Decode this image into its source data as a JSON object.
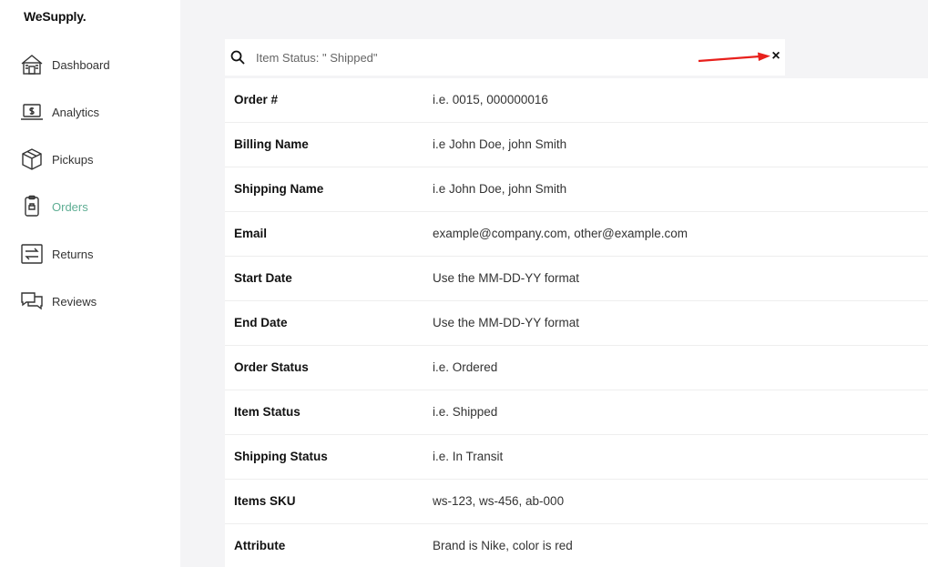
{
  "app": {
    "logo": "WeSupply."
  },
  "sidebar": {
    "items": [
      {
        "label": "Dashboard",
        "icon": "dashboard-icon",
        "active": false
      },
      {
        "label": "Analytics",
        "icon": "analytics-icon",
        "active": false
      },
      {
        "label": "Pickups",
        "icon": "pickups-icon",
        "active": false
      },
      {
        "label": "Orders",
        "icon": "orders-icon",
        "active": true
      },
      {
        "label": "Returns",
        "icon": "returns-icon",
        "active": false
      },
      {
        "label": "Reviews",
        "icon": "reviews-icon",
        "active": false
      }
    ]
  },
  "search": {
    "value": "Item Status: \" Shipped\"",
    "close_icon": "×"
  },
  "filters": [
    {
      "label": "Order #",
      "hint": "i.e. 0015, 000000016"
    },
    {
      "label": "Billing Name",
      "hint": "i.e John Doe, john Smith"
    },
    {
      "label": "Shipping Name",
      "hint": "i.e John Doe, john Smith"
    },
    {
      "label": "Email",
      "hint": "example@company.com, other@example.com"
    },
    {
      "label": "Start Date",
      "hint": "Use the MM-DD-YY format"
    },
    {
      "label": "End Date",
      "hint": "Use the MM-DD-YY format"
    },
    {
      "label": "Order Status",
      "hint": "i.e. Ordered"
    },
    {
      "label": "Item Status",
      "hint": "i.e. Shipped"
    },
    {
      "label": "Shipping Status",
      "hint": "i.e. In Transit"
    },
    {
      "label": "Items SKU",
      "hint": "ws-123, ws-456, ab-000"
    },
    {
      "label": "Attribute",
      "hint": "Brand is Nike, color is red"
    }
  ],
  "colors": {
    "active_nav": "#5fae94",
    "annotation_arrow": "#e8201c",
    "background": "#f4f4f6"
  }
}
